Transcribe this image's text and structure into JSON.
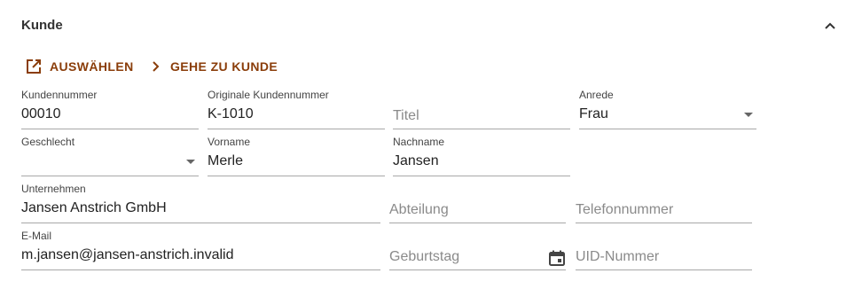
{
  "section": {
    "title": "Kunde",
    "collapse_icon": "chevron-up-icon"
  },
  "actions": [
    {
      "label": "AUSWÄHLEN",
      "icon": "open-in-new-icon"
    },
    {
      "label": "GEHE ZU KUNDE",
      "icon": "chevron-right-icon"
    }
  ],
  "fields": {
    "kundennummer": {
      "label": "Kundennummer",
      "value": "00010"
    },
    "orig_kundennummer": {
      "label": "Originale Kundennummer",
      "value": "K-1010"
    },
    "titel": {
      "placeholder": "Titel"
    },
    "anrede": {
      "label": "Anrede",
      "value": "Frau"
    },
    "geschlecht": {
      "label": "Geschlecht",
      "value": ""
    },
    "vorname": {
      "label": "Vorname",
      "value": "Merle"
    },
    "nachname": {
      "label": "Nachname",
      "value": "Jansen"
    },
    "unternehmen": {
      "label": "Unternehmen",
      "value": "Jansen Anstrich GmbH"
    },
    "abteilung": {
      "placeholder": "Abteilung"
    },
    "telefon": {
      "placeholder": "Telefonnummer"
    },
    "email": {
      "label": "E-Mail",
      "value": "m.jansen@jansen-anstrich.invalid"
    },
    "geburtstag": {
      "placeholder": "Geburtstag"
    },
    "uid": {
      "placeholder": "UID-Nummer"
    }
  },
  "colors": {
    "accent": "#8a3d0a",
    "underline": "#a8a8a8"
  }
}
